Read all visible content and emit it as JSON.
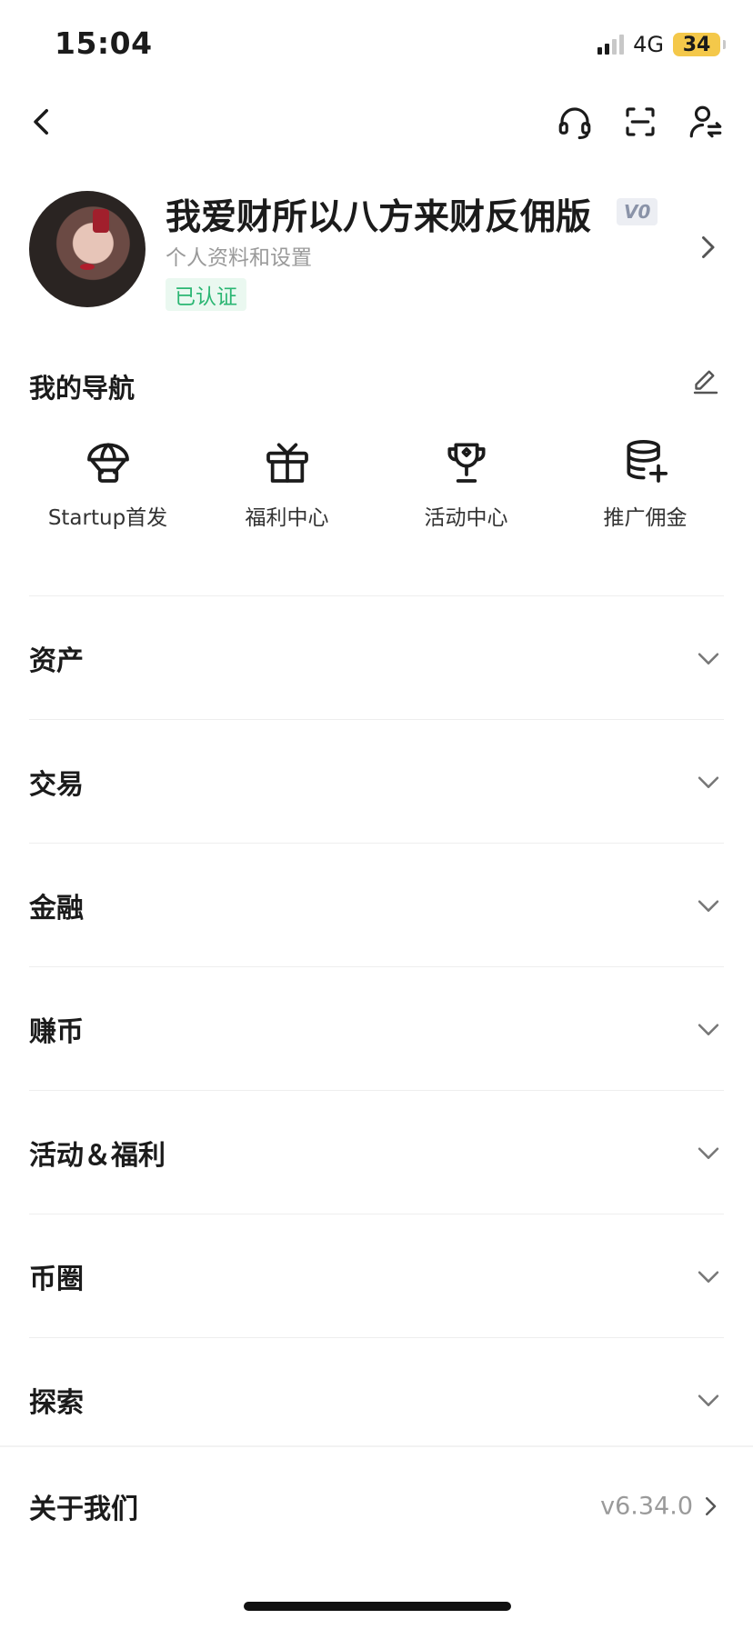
{
  "status_bar": {
    "time": "15:04",
    "network": "4G",
    "battery": "34"
  },
  "top_nav": {
    "back_icon": "chevron-left-icon",
    "support_icon": "headset-icon",
    "scan_icon": "scan-icon",
    "switch_account_icon": "user-switch-icon"
  },
  "profile": {
    "name": "我爱财所以八方来财反佣版",
    "vip": "V0",
    "subtitle": "个人资料和设置",
    "verified": "已认证"
  },
  "my_nav": {
    "title": "我的导航",
    "items": [
      {
        "label": "Startup首发",
        "icon": "parachute-icon"
      },
      {
        "label": "福利中心",
        "icon": "gift-icon"
      },
      {
        "label": "活动中心",
        "icon": "trophy-icon"
      },
      {
        "label": "推广佣金",
        "icon": "coins-plus-icon"
      }
    ]
  },
  "menu": {
    "items": [
      {
        "label": "资产"
      },
      {
        "label": "交易"
      },
      {
        "label": "金融"
      },
      {
        "label": "赚币"
      },
      {
        "label": "活动＆福利"
      },
      {
        "label": "币圈"
      },
      {
        "label": "探索"
      }
    ]
  },
  "about": {
    "label": "关于我们",
    "version": "v6.34.0"
  },
  "colors": {
    "accent_green": "#2bb673",
    "battery_yellow": "#f4c84a"
  }
}
